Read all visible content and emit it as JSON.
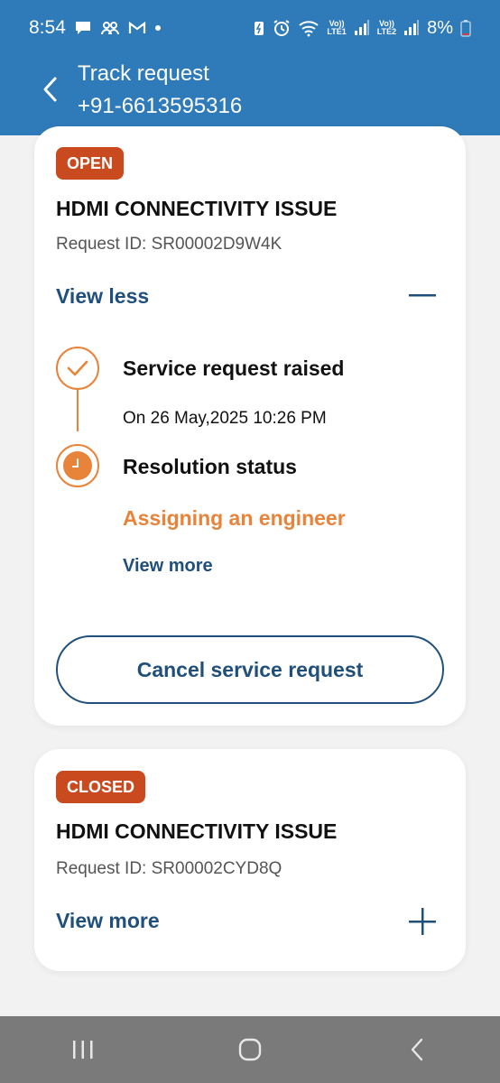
{
  "status_bar": {
    "time": "8:54",
    "battery": "8%",
    "lte1": "LTE1",
    "lte2": "LTE2",
    "volte": "Vo))"
  },
  "header": {
    "title": "Track request",
    "subtitle": "+91-6613595316"
  },
  "requests": [
    {
      "status": "OPEN",
      "status_color": "#c94a1f",
      "title": "HDMI CONNECTIVITY ISSUE",
      "request_id": "Request ID: SR00002D9W4K",
      "toggle_label": "View less",
      "timeline": [
        {
          "title": "Service request raised",
          "detail": "On 26 May,2025 10:26 PM",
          "icon": "check-icon"
        },
        {
          "title": "Resolution status",
          "detail": "Assigning an engineer",
          "link": "View more",
          "icon": "clock-icon"
        }
      ],
      "action_label": "Cancel service request"
    },
    {
      "status": "CLOSED",
      "status_color": "#c94a1f",
      "title": "HDMI CONNECTIVITY ISSUE",
      "request_id": "Request ID: SR00002CYD8Q",
      "toggle_label": "View more"
    }
  ],
  "colors": {
    "header_bg": "#2f7ab8",
    "accent_orange": "#e8833a",
    "link_blue": "#1f4f7a"
  }
}
